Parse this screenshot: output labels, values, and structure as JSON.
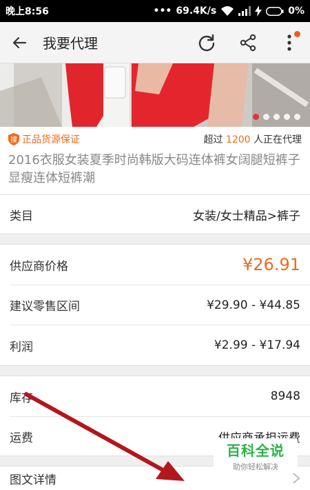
{
  "status_bar": {
    "time": "晚上8:56",
    "network_speed": "69.4K/s",
    "battery": "0%"
  },
  "app_bar": {
    "title": "我要代理"
  },
  "banner": {
    "page_count": 5,
    "active_index": 0
  },
  "guarantee": {
    "badge_icon_text": "搜",
    "badge_label": "正品货源保证",
    "prefix": "超过 ",
    "count": "1200",
    "suffix": " 人正在代理"
  },
  "product": {
    "title": "2016衣服女装夏季时尚韩版大码连体裤女阔腿短裤子显瘦连体短裤潮"
  },
  "category": {
    "label": "类目",
    "value": "女装/女士精品>裤子"
  },
  "pricing": {
    "supplier_price_label": "供应商价格",
    "supplier_price": "¥26.91",
    "retail_range_label": "建议零售区间",
    "retail_range": "¥29.90 - ¥44.85",
    "profit_label": "利润",
    "profit": "¥2.99 - ¥17.94"
  },
  "stock": {
    "label": "库存",
    "value": "8948"
  },
  "shipping": {
    "label": "运费",
    "value": "供应商承担运费"
  },
  "details": {
    "label": "图文详情"
  },
  "watermark": {
    "title": "百科全说",
    "subtitle": "助你轻松解决"
  },
  "colors": {
    "accent": "#f06a1a",
    "indicator_active": "#e8303a",
    "annotation_arrow": "#b3161d",
    "watermark_green": "#2db24a"
  }
}
